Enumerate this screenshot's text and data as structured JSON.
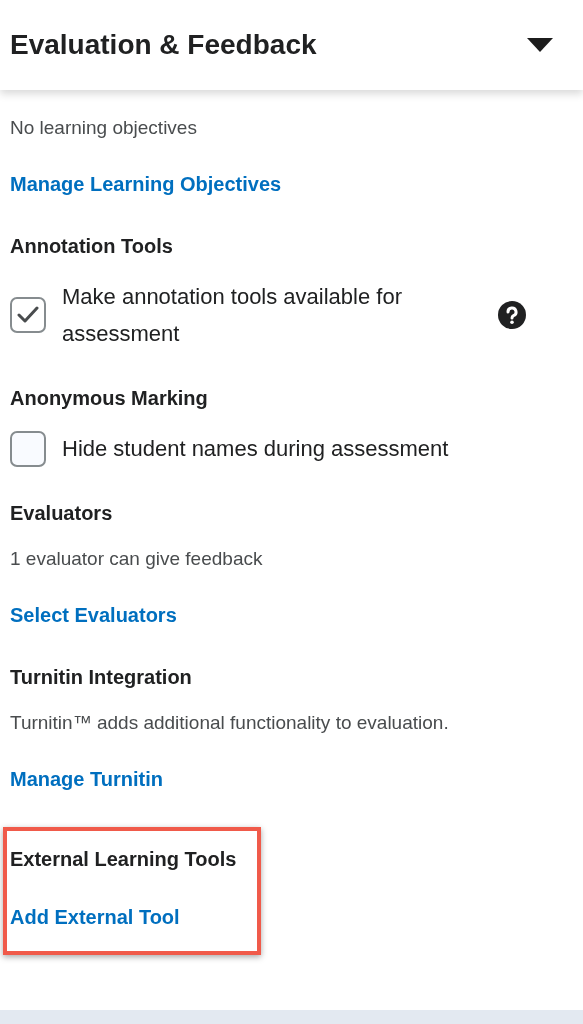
{
  "header": {
    "title": "Evaluation & Feedback"
  },
  "sections": [
    {
      "highlighted": false,
      "items": [
        {
          "kind": "text",
          "text": "No learning objectives"
        },
        {
          "kind": "link",
          "text": "Manage Learning Objectives"
        }
      ]
    },
    {
      "heading": "Annotation Tools",
      "highlighted": false,
      "items": [
        {
          "kind": "checkbox",
          "text": "Make annotation tools available for assessment",
          "checked": true,
          "help": true
        }
      ]
    },
    {
      "heading": "Anonymous Marking",
      "highlighted": false,
      "items": [
        {
          "kind": "checkbox",
          "text": "Hide student names during assessment",
          "checked": false,
          "help": false
        }
      ]
    },
    {
      "heading": "Evaluators",
      "highlighted": false,
      "items": [
        {
          "kind": "text",
          "text": "1 evaluator can give feedback"
        },
        {
          "kind": "link",
          "text": "Select Evaluators"
        }
      ]
    },
    {
      "heading": "Turnitin Integration",
      "highlighted": false,
      "items": [
        {
          "kind": "text",
          "text": "Turnitin™ adds additional functionality to evaluation."
        },
        {
          "kind": "link",
          "text": "Manage Turnitin"
        }
      ]
    },
    {
      "heading": "External Learning Tools",
      "highlighted": true,
      "items": [
        {
          "kind": "link",
          "text": "Add External Tool"
        }
      ]
    }
  ]
}
